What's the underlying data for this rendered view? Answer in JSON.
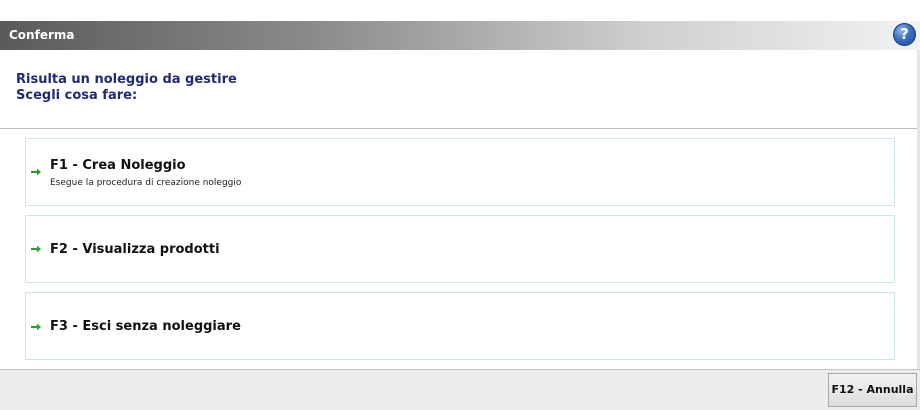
{
  "dialog": {
    "title": "Conferma",
    "help_label": "?"
  },
  "message": {
    "line1": "Risulta un noleggio da gestire",
    "line2": "Scegli cosa fare:"
  },
  "options": [
    {
      "label": "F1 - Crea Noleggio",
      "description": "Esegue la procedura di creazione noleggio",
      "icon": "green-arrow-right-icon"
    },
    {
      "label": "F2 - Visualizza prodotti",
      "description": "",
      "icon": "green-arrow-right-icon"
    },
    {
      "label": "F3 - Esci senza noleggiare",
      "description": "",
      "icon": "green-arrow-right-icon"
    }
  ],
  "footer": {
    "cancel_label": "F12 - Annulla"
  },
  "colors": {
    "message_text": "#1f2a78",
    "arrow": "#1fa51f",
    "option_border": "#cfe3ea"
  }
}
